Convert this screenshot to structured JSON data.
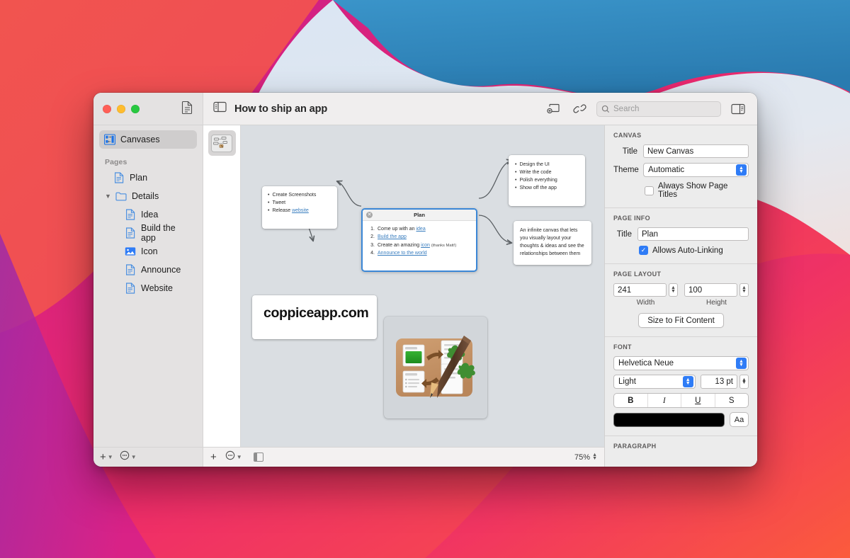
{
  "window": {
    "document_title": "How to ship an app",
    "traffic_lights": [
      "close-button",
      "minimize-button",
      "zoom-button"
    ],
    "toolbar": {
      "sidebar_toggle_icon": "sidebar-toggle-icon",
      "page_icon": "document-page-icon",
      "new_page_icon": "new-page-icon",
      "link_icon": "link-icon",
      "inspector_toggle_icon": "inspector-toggle-icon",
      "search_placeholder": "Search",
      "search_value": ""
    }
  },
  "sidebar": {
    "top_item": {
      "label": "Canvases",
      "icon": "canvases-icon",
      "selected": true
    },
    "section_label": "Pages",
    "items": [
      {
        "label": "Plan",
        "icon": "page-icon",
        "indent": 1,
        "expandable": false
      },
      {
        "label": "Details",
        "icon": "folder-icon",
        "indent": 1,
        "expandable": true,
        "expanded": true
      },
      {
        "label": "Idea",
        "icon": "page-icon",
        "indent": 2,
        "expandable": false
      },
      {
        "label": "Build the app",
        "icon": "page-icon",
        "indent": 2,
        "expandable": false
      },
      {
        "label": "Icon",
        "icon": "image-page-icon",
        "indent": 2,
        "expandable": false
      },
      {
        "label": "Announce",
        "icon": "page-icon",
        "indent": 2,
        "expandable": false
      },
      {
        "label": "Website",
        "icon": "page-icon",
        "indent": 2,
        "expandable": false
      }
    ],
    "footer": {
      "add_icon": "plus-icon",
      "add_chevron": "chevron-down-icon",
      "more_icon": "more-ellipsis-icon",
      "more_chevron": "chevron-down-icon"
    }
  },
  "canvas": {
    "thumbnail_label": "canvas-thumbnail",
    "zoom_level": "75%",
    "footer": {
      "add_icon": "plus-icon",
      "more_icon": "more-ellipsis-icon",
      "more_chevron": "chevron-down-icon",
      "layout_icon": "page-layout-icon"
    },
    "nodes": {
      "release": {
        "items": [
          {
            "text": "Create Screenshots"
          },
          {
            "text": "Tweet"
          },
          {
            "text": "Release ",
            "link": "website"
          }
        ]
      },
      "plan": {
        "title": "Plan",
        "close_icon": "close-node-icon",
        "items": [
          {
            "num": "1.",
            "pre": "Come up with an ",
            "link": "idea",
            "post": ""
          },
          {
            "num": "2.",
            "pre": "",
            "link": "Build the app",
            "post": ""
          },
          {
            "num": "3.",
            "pre": "Create an amazing ",
            "link": "icon",
            "post": "",
            "note": "(thanks Matt!)"
          },
          {
            "num": "4.",
            "pre": "",
            "link": "Announce to the world",
            "post": ""
          }
        ]
      },
      "build": {
        "items": [
          {
            "text": "Design the UI"
          },
          {
            "text": "Write the code"
          },
          {
            "text": "Polish everything"
          },
          {
            "text": "Show off the app"
          }
        ]
      },
      "idea": {
        "text": "An infinite canvas that lets you visually layout your thoughts & ideas and see the relationships between them"
      },
      "website": {
        "text": "coppiceapp.com"
      },
      "image": {
        "label": "coppice-app-icon"
      }
    }
  },
  "inspector": {
    "canvas": {
      "heading": "CANVAS",
      "title_label": "Title",
      "title_value": "New Canvas",
      "theme_label": "Theme",
      "theme_value": "Automatic",
      "always_show_label": "Always Show Page Titles",
      "always_show_checked": false
    },
    "page_info": {
      "heading": "PAGE INFO",
      "title_label": "Title",
      "title_value": "Plan",
      "auto_link_label": "Allows Auto-Linking",
      "auto_link_checked": true
    },
    "page_layout": {
      "heading": "PAGE LAYOUT",
      "width_value": "241",
      "width_label": "Width",
      "height_value": "100",
      "height_label": "Height",
      "fit_button": "Size to Fit Content"
    },
    "font": {
      "heading": "FONT",
      "family": "Helvetica Neue",
      "weight": "Light",
      "size": "13 pt",
      "bold": "B",
      "italic": "I",
      "underline": "U",
      "strike": "S",
      "color": "#000000",
      "aa_button": "Aa"
    },
    "paragraph": {
      "heading": "PARAGRAPH"
    }
  },
  "theme_colors": {
    "accent_blue": "#2f7cf6",
    "node_selected_border": "#3b87d6",
    "link_blue": "#3a7ebf",
    "canvas_background": "#dadee2"
  }
}
